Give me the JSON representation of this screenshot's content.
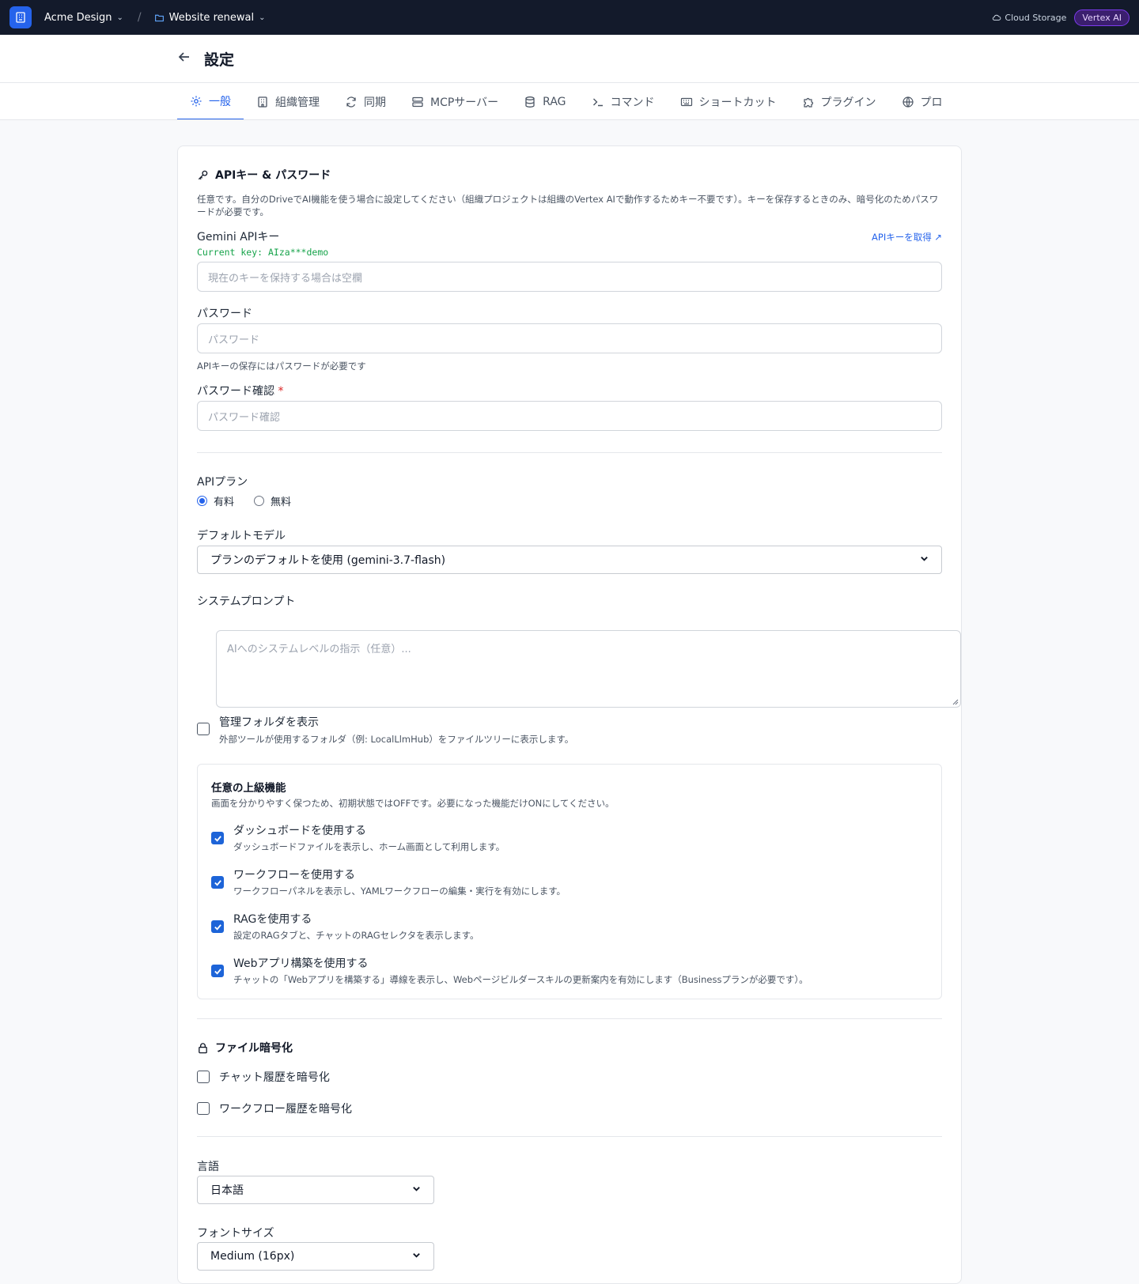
{
  "topbar": {
    "org": "Acme Design",
    "project": "Website renewal",
    "storage": "Cloud Storage",
    "badge": "Vertex AI"
  },
  "header": {
    "title": "設定"
  },
  "tabs": [
    {
      "label": "一般",
      "icon": "gear-icon"
    },
    {
      "label": "組織管理",
      "icon": "building-icon"
    },
    {
      "label": "同期",
      "icon": "sync-icon"
    },
    {
      "label": "MCPサーバー",
      "icon": "server-icon"
    },
    {
      "label": "RAG",
      "icon": "database-icon"
    },
    {
      "label": "コマンド",
      "icon": "terminal-icon"
    },
    {
      "label": "ショートカット",
      "icon": "keyboard-icon"
    },
    {
      "label": "プラグイン",
      "icon": "puzzle-icon"
    },
    {
      "label": "プロ",
      "icon": "globe-icon"
    }
  ],
  "api": {
    "title": "APIキー & パスワード",
    "desc": "任意です。自分のDriveでAI機能を使う場合に設定してください（組織プロジェクトは組織のVertex AIで動作するためキー不要です）。キーを保存するときのみ、暗号化のためパスワードが必要です。",
    "gemini_label": "Gemini APIキー",
    "get_key_link": "APIキーを取得 ↗",
    "current_key": "Current key: AIza***demo",
    "key_placeholder": "現在のキーを保持する場合は空欄",
    "password_label": "パスワード",
    "password_placeholder": "パスワード",
    "password_hint": "APIキーの保存にはパスワードが必要です",
    "confirm_label": "パスワード確認",
    "confirm_required": "*",
    "confirm_placeholder": "パスワード確認"
  },
  "plan": {
    "label": "APIプラン",
    "options": [
      "有料",
      "無料"
    ],
    "selected": "有料"
  },
  "model": {
    "label": "デフォルトモデル",
    "value": "プランのデフォルトを使用 (gemini-3.7-flash)"
  },
  "prompt": {
    "label": "システムプロンプト",
    "placeholder": "AIへのシステムレベルの指示（任意）..."
  },
  "manage_folder": {
    "label": "管理フォルダを表示",
    "desc": "外部ツールが使用するフォルダ（例: LocalLlmHub）をファイルツリーに表示します。",
    "checked": false
  },
  "advanced": {
    "title": "任意の上級機能",
    "desc": "画面を分かりやすく保つため、初期状態ではOFFです。必要になった機能だけONにしてください。",
    "items": [
      {
        "label": "ダッシュボードを使用する",
        "desc": "ダッシュボードファイルを表示し、ホーム画面として利用します。",
        "checked": true
      },
      {
        "label": "ワークフローを使用する",
        "desc": "ワークフローパネルを表示し、YAMLワークフローの編集・実行を有効にします。",
        "checked": true
      },
      {
        "label": "RAGを使用する",
        "desc": "設定のRAGタブと、チャットのRAGセレクタを表示します。",
        "checked": true
      },
      {
        "label": "Webアプリ構築を使用する",
        "desc": "チャットの「Webアプリを構築する」導線を表示し、Webページビルダースキルの更新案内を有効にします（Businessプランが必要です）。",
        "checked": true
      }
    ]
  },
  "encryption": {
    "title": "ファイル暗号化",
    "items": [
      {
        "label": "チャット履歴を暗号化",
        "checked": false
      },
      {
        "label": "ワークフロー履歴を暗号化",
        "checked": false
      }
    ]
  },
  "language": {
    "label": "言語",
    "value": "日本語"
  },
  "font_size": {
    "label": "フォントサイズ",
    "value": "Medium (16px)"
  },
  "colors": {
    "accent": "#2563eb",
    "topbar": "#131a2b",
    "success": "#16a34a"
  }
}
